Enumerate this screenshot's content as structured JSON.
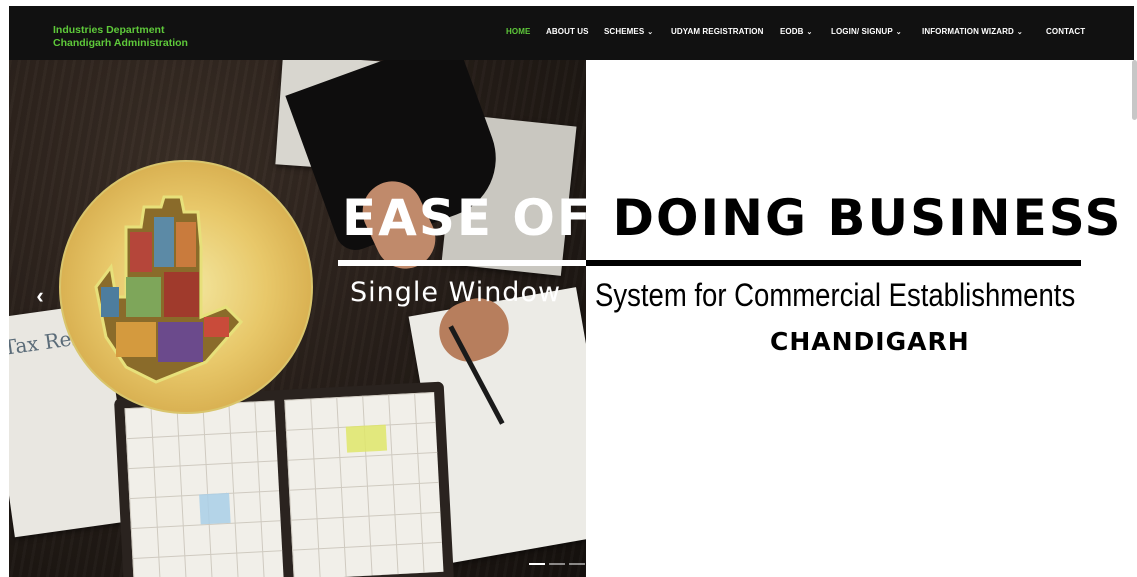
{
  "brand": {
    "line1": "Industries Department",
    "line2": "Chandigarh Administration"
  },
  "nav": {
    "items": [
      {
        "label": "HOME",
        "active": true,
        "dropdown": false
      },
      {
        "label": "ABOUT US",
        "active": false,
        "dropdown": false
      },
      {
        "label": "SCHEMES",
        "active": false,
        "dropdown": true
      },
      {
        "label": "UDYAM REGISTRATION",
        "active": false,
        "dropdown": false
      },
      {
        "label": "EODB",
        "active": false,
        "dropdown": true
      },
      {
        "label": "LOGIN/ SIGNUP",
        "active": false,
        "dropdown": true
      },
      {
        "label": "INFORMATION WIZARD",
        "active": false,
        "dropdown": true
      },
      {
        "label": "CONTACT",
        "active": false,
        "dropdown": false
      }
    ],
    "chevron": "⌄"
  },
  "hero": {
    "title_part1": "EASE OF ",
    "title_part2": "DOING BUSINESS",
    "subtitle_part1": "Single Window ",
    "subtitle_part2": "System for Commercial Establishments",
    "city": "CHANDIGARH",
    "photo_label": "Tax Refund",
    "prev_icon": "‹"
  },
  "carousel": {
    "slides": 3,
    "active_index": 0
  },
  "colors": {
    "navbar_bg": "#111111",
    "brand_green": "#5ec93a",
    "active_nav": "#5ec93a"
  }
}
